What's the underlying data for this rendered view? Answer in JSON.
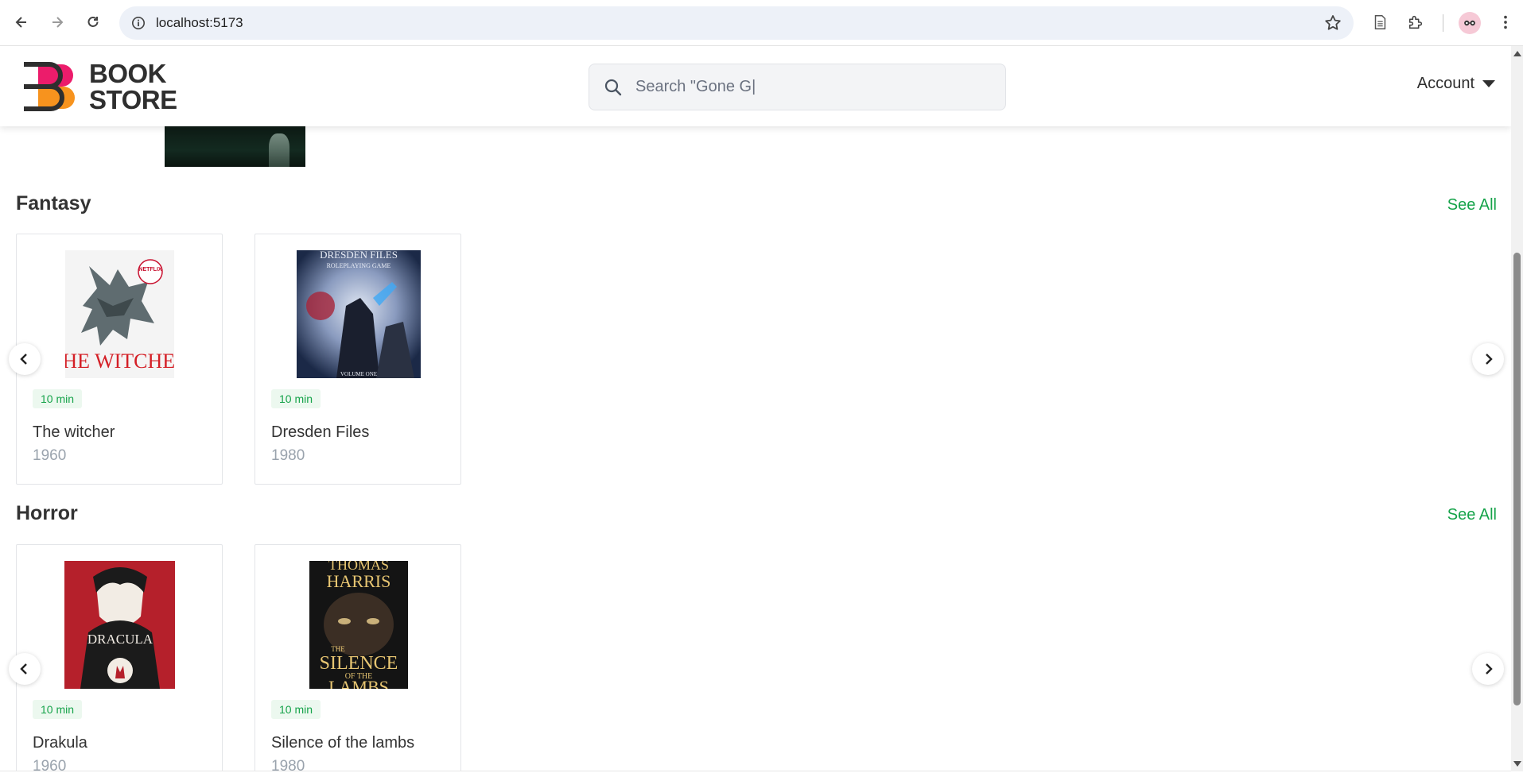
{
  "browser": {
    "url": "localhost:5173",
    "icons": [
      "back-arrow-icon",
      "forward-arrow-icon",
      "reload-icon",
      "site-info-icon",
      "bookmark-star-icon",
      "reading-list-icon",
      "extensions-puzzle-icon",
      "profile-avatar",
      "more-menu-icon"
    ]
  },
  "header": {
    "logo_line1": "BOOK",
    "logo_line2": "STORE",
    "search_placeholder": "Search \"Gone G|",
    "account_label": "Account"
  },
  "colors": {
    "accent_green": "#16a34a",
    "logo_pink": "#ec1c6b",
    "logo_orange": "#f7931e",
    "badge_bg": "#ecf8ef"
  },
  "sections": [
    {
      "title": "Fantasy",
      "see_all": "See All",
      "books": [
        {
          "cover_text": "THE WITCHER",
          "cover_badge": "NETFLIX",
          "duration": "10 min",
          "title": "The witcher",
          "year": "1960"
        },
        {
          "cover_text": "DRESDEN FILES",
          "cover_subtitle": "ROLEPLAYING GAME",
          "cover_footer": "VOLUME ONE",
          "duration": "10 min",
          "title": "Dresden Files",
          "year": "1980"
        }
      ]
    },
    {
      "title": "Horror",
      "see_all": "See All",
      "books": [
        {
          "cover_text": "DRACULA",
          "duration": "10 min",
          "title": "Drakula",
          "year": "1960"
        },
        {
          "cover_author1": "THOMAS",
          "cover_author2": "HARRIS",
          "cover_line1": "THE",
          "cover_line2": "SILENCE",
          "cover_line3": "OF THE",
          "cover_line4": "LAMBS",
          "duration": "10 min",
          "title": "Silence of the lambs",
          "year": "1980"
        }
      ]
    }
  ]
}
